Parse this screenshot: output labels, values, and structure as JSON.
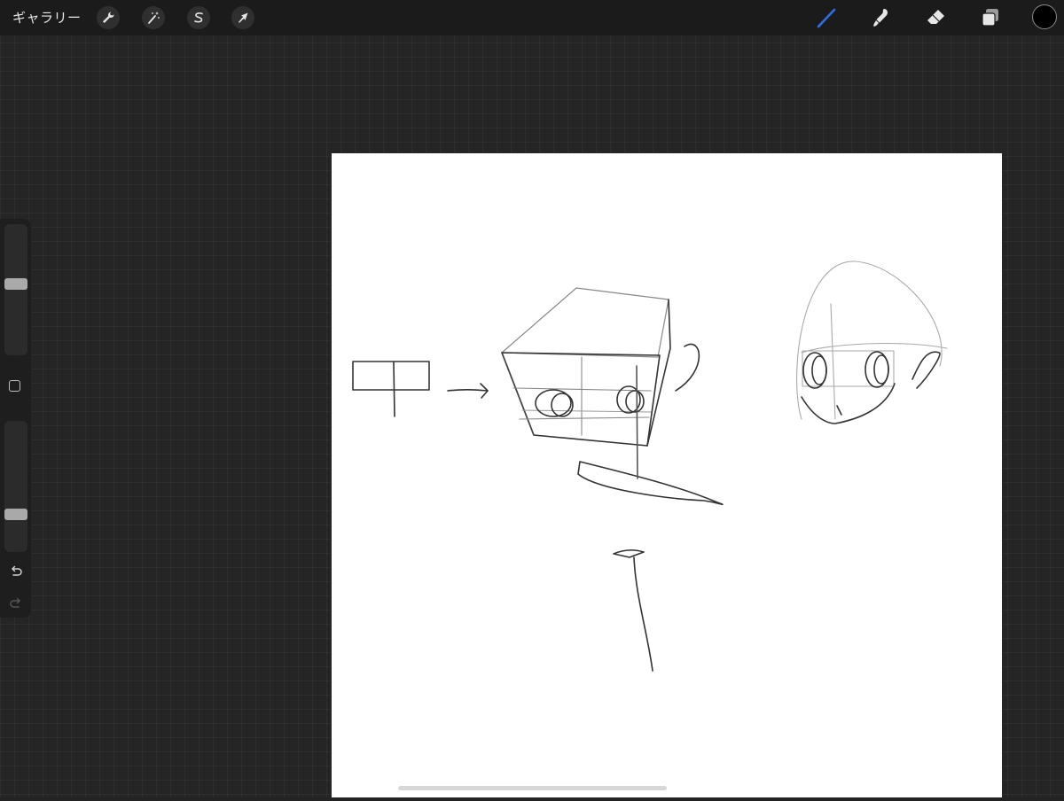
{
  "topbar": {
    "gallery_label": "ギャラリー",
    "left_tools": [
      {
        "icon": "wrench-icon",
        "name": "actions"
      },
      {
        "icon": "magic-wand-icon",
        "name": "adjustments"
      },
      {
        "icon": "selection-s-icon",
        "name": "selection"
      },
      {
        "icon": "arrow-cursor-icon",
        "name": "transform"
      }
    ],
    "right_tools": [
      {
        "icon": "brush-icon",
        "name": "paint",
        "active": true
      },
      {
        "icon": "smudge-icon",
        "name": "smudge"
      },
      {
        "icon": "eraser-icon",
        "name": "erase"
      },
      {
        "icon": "layers-icon",
        "name": "layers"
      }
    ],
    "active_color": "#2f6fe4",
    "current_color": "#000000"
  },
  "sidebar": {
    "brush_size_level": 0.55,
    "opacity_level": 0.25
  },
  "colors": {
    "workspace_bg": "#252525",
    "topbar_bg": "#1b1b1b",
    "canvas_bg": "#ffffff",
    "sketch_stroke": "#333333"
  }
}
